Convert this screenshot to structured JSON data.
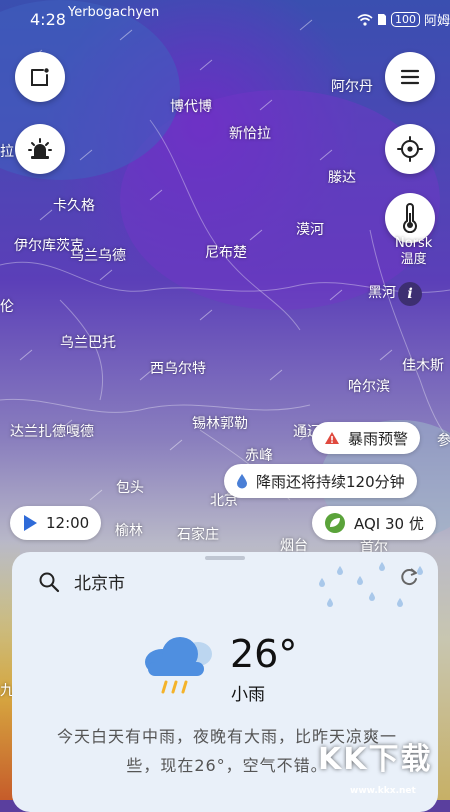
{
  "status": {
    "time": "4:28",
    "carrier": "Yerbogachyen",
    "battery": "100",
    "right_text": "阿姆"
  },
  "map": {
    "cities": [
      {
        "name": "阿尔丹"
      },
      {
        "name": "博代博"
      },
      {
        "name": "新恰拉"
      },
      {
        "name": "拉"
      },
      {
        "name": "滕达"
      },
      {
        "name": "卡久格"
      },
      {
        "name": "漠河"
      },
      {
        "name": "伊尔库茨克"
      },
      {
        "name": "乌兰乌德"
      },
      {
        "name": "尼布楚"
      },
      {
        "name": "黑河"
      },
      {
        "name": "伦"
      },
      {
        "name": "乌兰巴托"
      },
      {
        "name": "佳木斯"
      },
      {
        "name": "西乌尔特"
      },
      {
        "name": "哈尔滨"
      },
      {
        "name": "锡林郭勒"
      },
      {
        "name": "达兰扎德嘎德"
      },
      {
        "name": "通辽"
      },
      {
        "name": "赤峰"
      },
      {
        "name": "参"
      },
      {
        "name": "包头"
      },
      {
        "name": "北京"
      },
      {
        "name": "榆林"
      },
      {
        "name": "石家庄"
      },
      {
        "name": "烟台"
      },
      {
        "name": "首尔"
      },
      {
        "name": "九"
      }
    ],
    "norsk_label": "Norsk",
    "temp_label": "温度",
    "info": "i"
  },
  "alerts": {
    "warning": "暴雨预警",
    "rain": "降雨还将持续120分钟",
    "aqi": "AQI 30 优",
    "play_time": "12:00"
  },
  "weather": {
    "location": "北京市",
    "temperature": "26°",
    "condition": "小雨",
    "summary": "今天白天有中雨，夜晚有大雨，比昨天凉爽一些，现在26°，空气不错。"
  },
  "watermark": {
    "main": "KK下载",
    "sub": "www.kkx.net"
  },
  "colors": {
    "accent": "#2f6bd8",
    "warning": "#e04a3f",
    "leaf": "#5aa33a"
  }
}
